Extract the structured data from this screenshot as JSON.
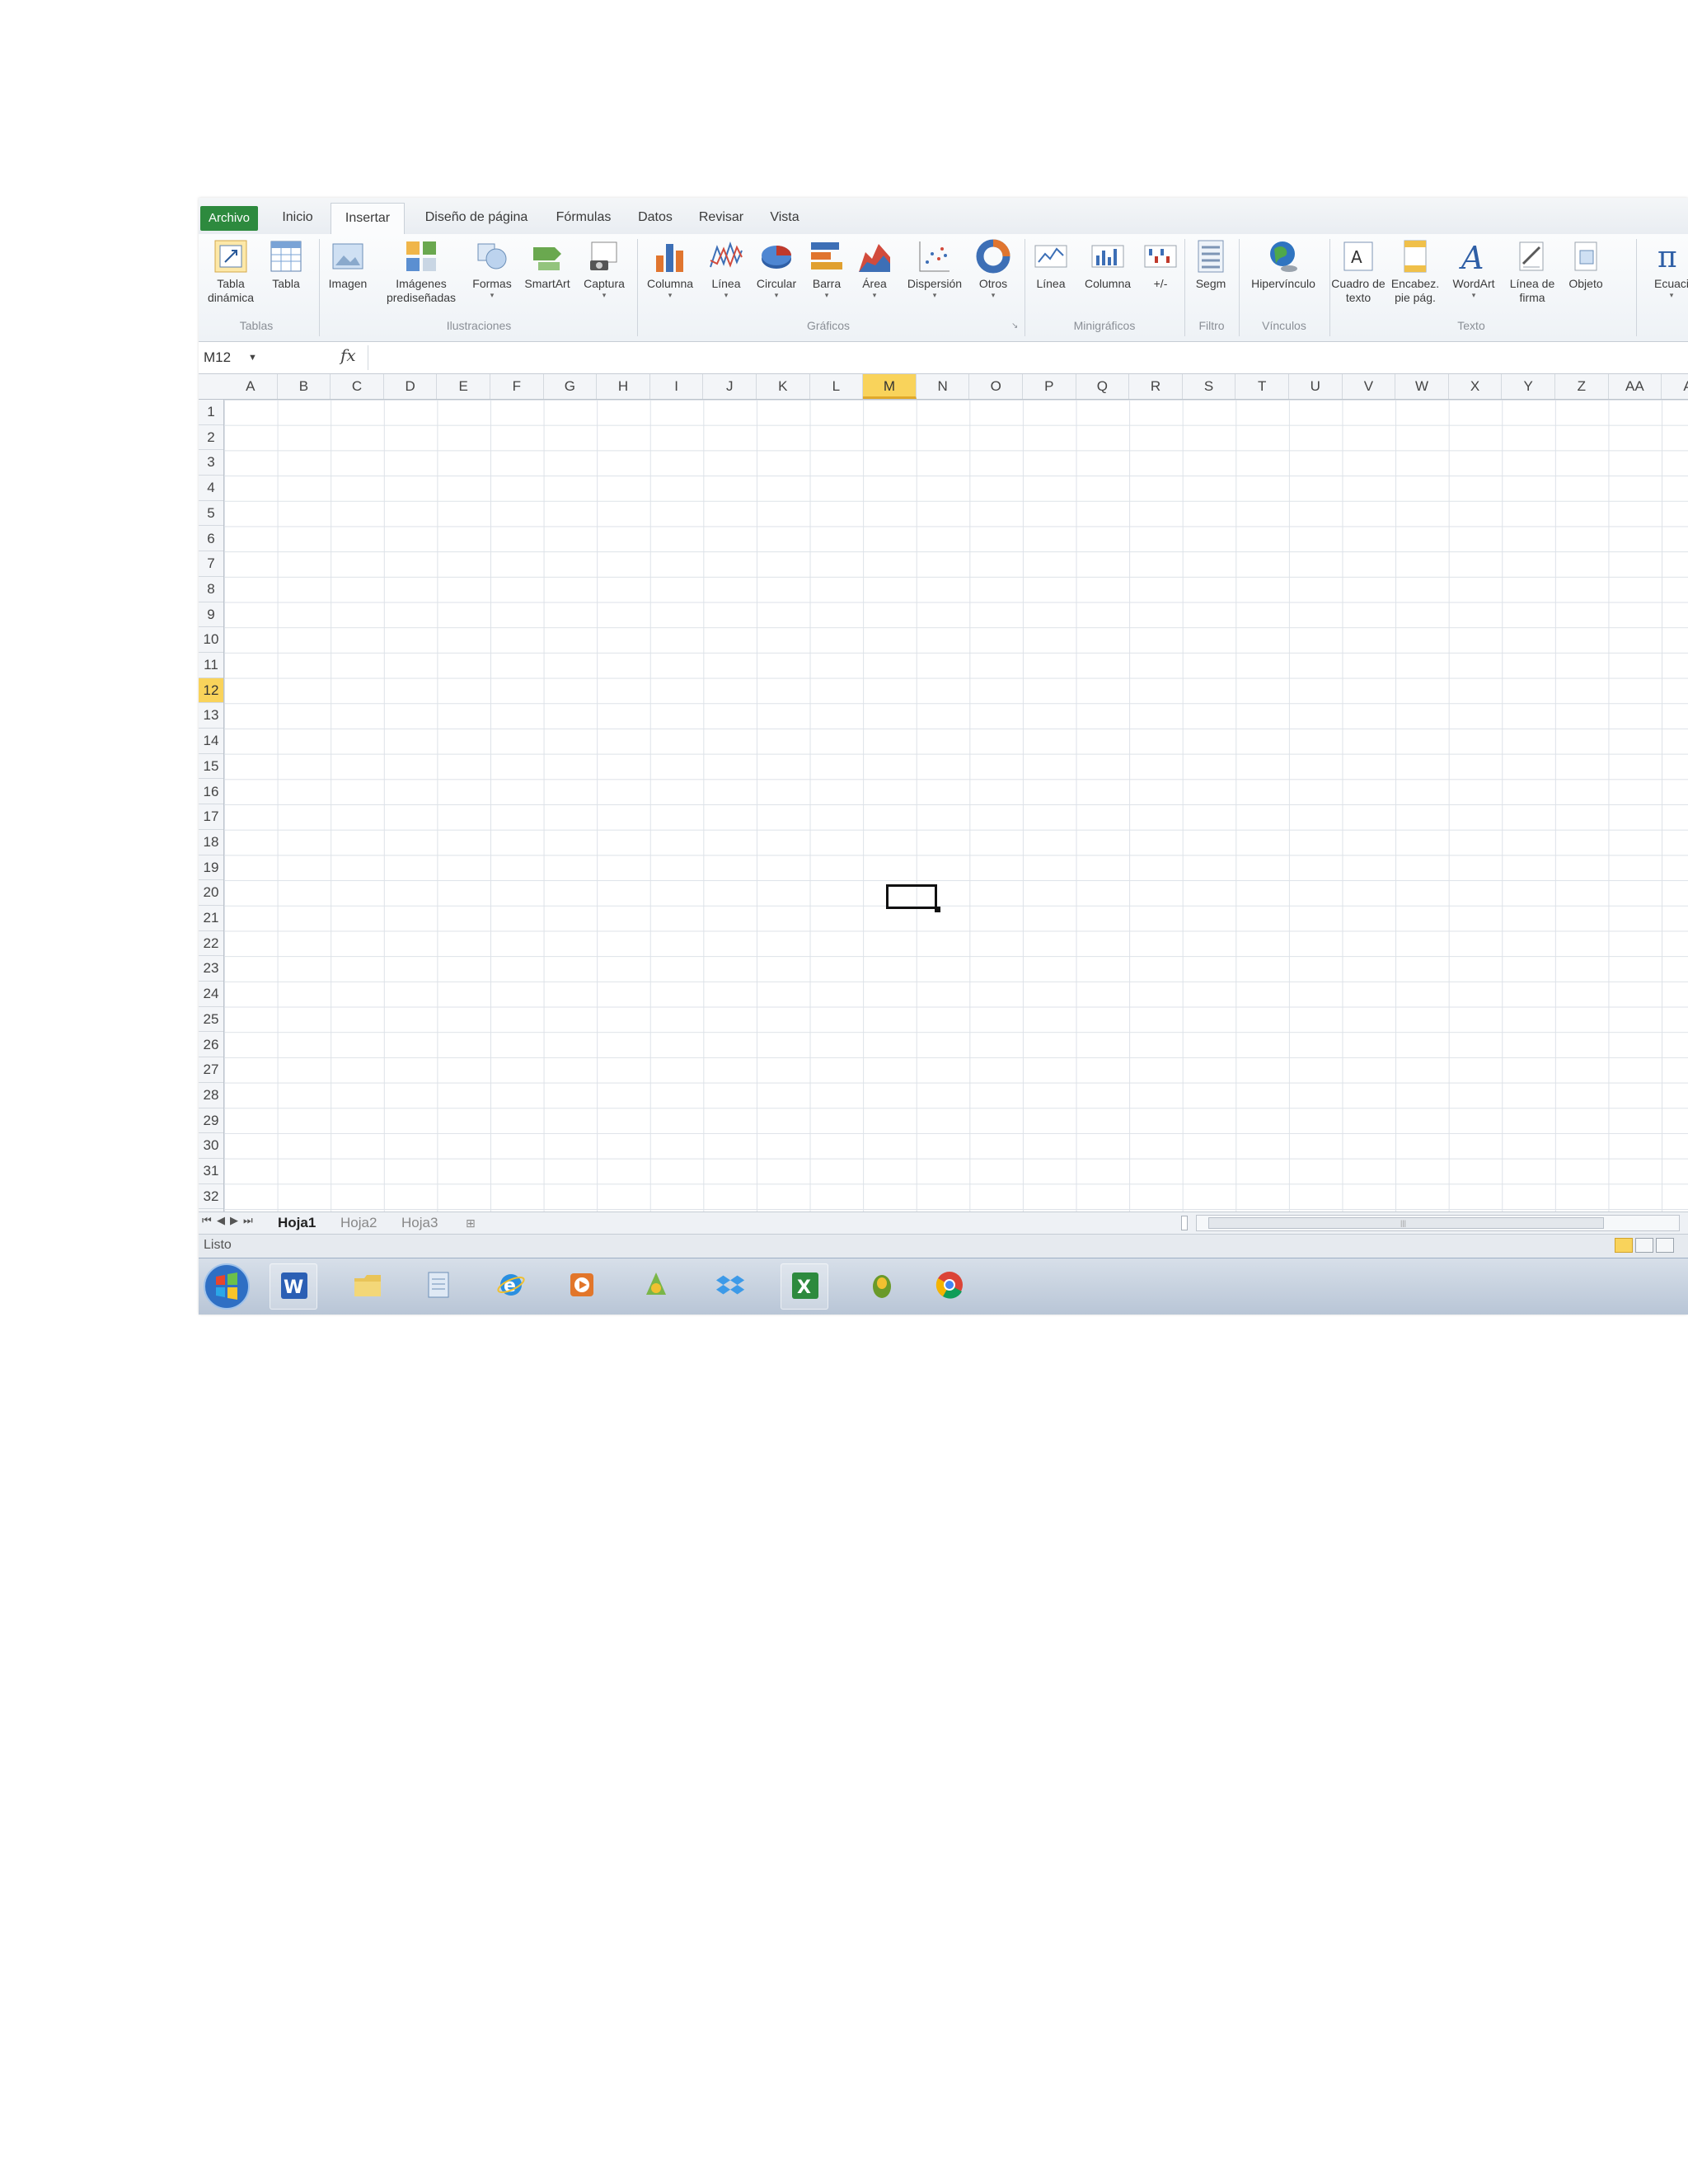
{
  "ribbon_tabs": [
    "Archivo",
    "Inicio",
    "Insertar",
    "Diseño de página",
    "Fórmulas",
    "Datos",
    "Revisar",
    "Vista"
  ],
  "active_tab": "Insertar",
  "ribbon": {
    "tabla_dinamica": "Tabla dinámica",
    "tabla": "Tabla",
    "imagen": "Imagen",
    "imagenes_prediseñadas": "Imágenes prediseñadas",
    "formas": "Formas",
    "smartart": "SmartArt",
    "captura": "Captura",
    "columna": "Columna",
    "linea": "Línea",
    "circular": "Circular",
    "barra": "Barra",
    "area": "Área",
    "dispersion": "Dispersión",
    "otros": "Otros",
    "mini_linea": "Línea",
    "mini_columna": "Columna",
    "mini_ganancia": "+/-",
    "segm": "Segm",
    "hipervinculo": "Hipervínculo",
    "cuadro_texto": "Cuadro de texto",
    "encabez": "Encabez. pie pág.",
    "wordart": "WordArt",
    "linea_firma": "Línea de firma",
    "objeto": "Objeto",
    "ecuacion": "Ecuaci"
  },
  "groups": {
    "tablas": "Tablas",
    "ilustraciones": "Ilustraciones",
    "graficos": "Gráficos",
    "minigraficos": "Minigráficos",
    "filtro": "Filtro",
    "vinculos": "Vínculos",
    "texto": "Texto"
  },
  "formula_bar": {
    "name_box": "M12",
    "fx": "fx",
    "formula": ""
  },
  "columns": [
    "A",
    "B",
    "C",
    "D",
    "E",
    "F",
    "G",
    "H",
    "I",
    "J",
    "K",
    "L",
    "M",
    "N",
    "O",
    "P",
    "Q",
    "R",
    "S",
    "T",
    "U",
    "V",
    "W",
    "X",
    "Y",
    "Z",
    "AA",
    "A"
  ],
  "rows": [
    "1",
    "2",
    "3",
    "4",
    "5",
    "6",
    "7",
    "8",
    "9",
    "10",
    "11",
    "12",
    "13",
    "14",
    "15",
    "16",
    "17",
    "18",
    "19",
    "20",
    "21",
    "22",
    "23",
    "24",
    "25",
    "26",
    "27",
    "28",
    "29",
    "30",
    "31",
    "32"
  ],
  "selected_cell": {
    "column": "M",
    "row": "12"
  },
  "sheet_tabs": [
    "Hoja1",
    "Hoja2",
    "Hoja3"
  ],
  "active_sheet": "Hoja1",
  "status": "Listo",
  "taskbar_icons": [
    "windows-start",
    "word",
    "file-explorer",
    "notepad",
    "internet-explorer",
    "media-player",
    "app-green",
    "dropbox",
    "excel",
    "app-egg",
    "chrome"
  ],
  "colors": {
    "excel_green": "#2d8a3e",
    "selection_yellow": "#f9d35b"
  }
}
